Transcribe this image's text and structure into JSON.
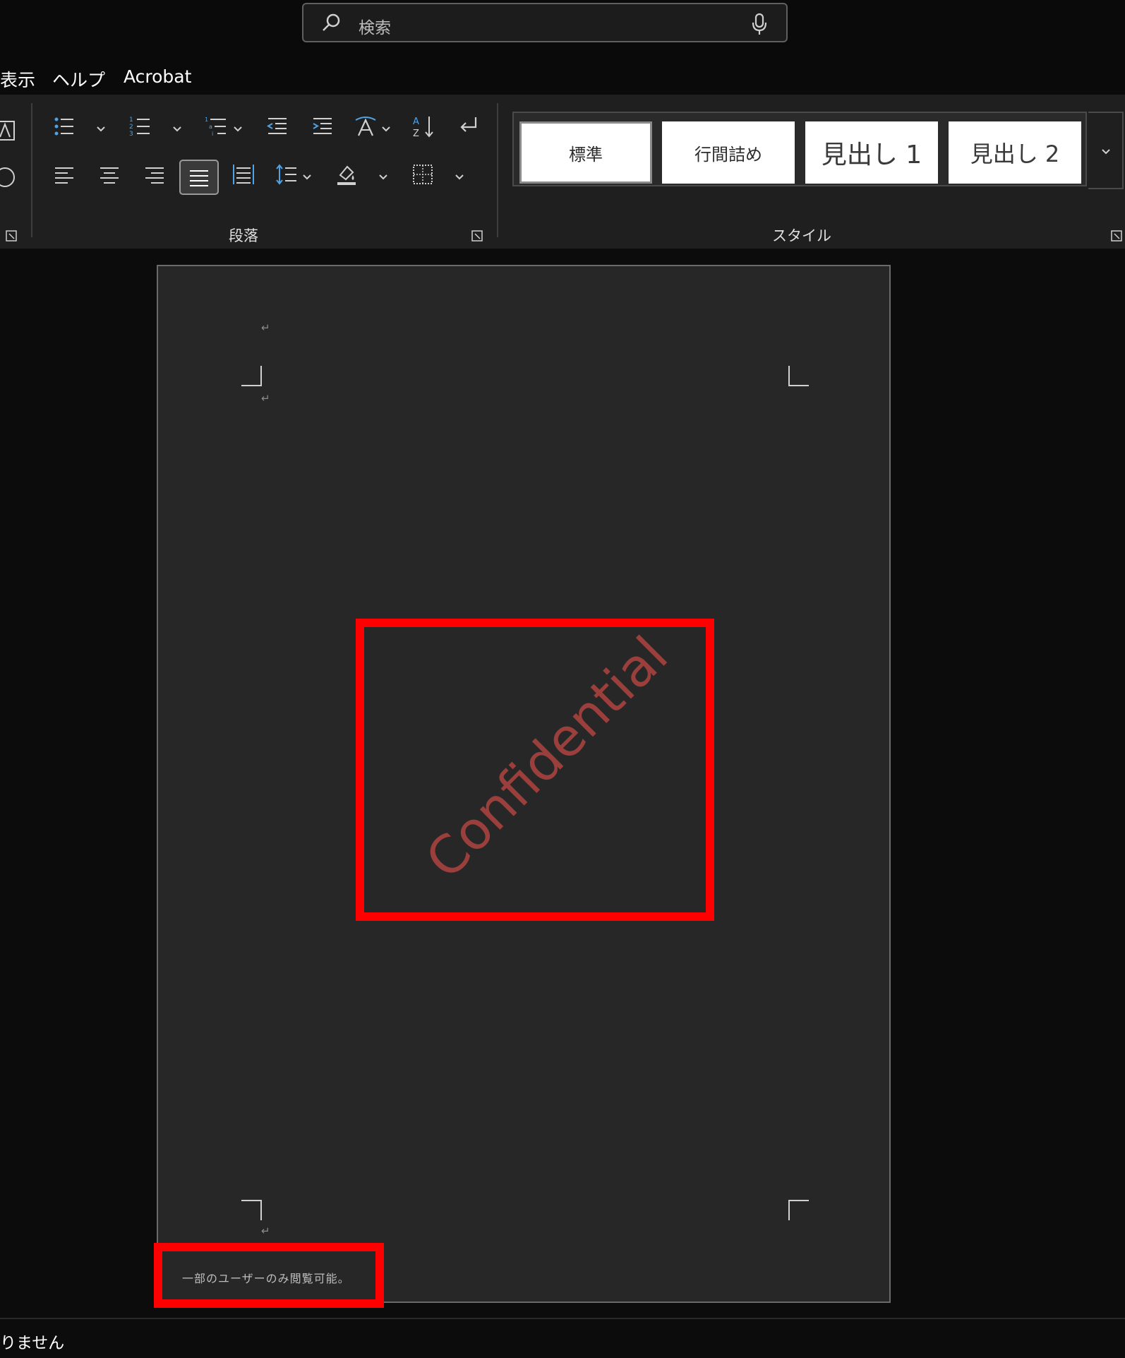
{
  "search": {
    "placeholder": "検索"
  },
  "menu": [
    "表示",
    "ヘルプ",
    "Acrobat"
  ],
  "ribbon": {
    "groups": {
      "paragraph": "段落",
      "styles": "スタイル"
    },
    "styles": [
      "標準",
      "行間詰め",
      "見出し 1",
      "見出し 2"
    ]
  },
  "document": {
    "watermark": "Confidential",
    "footer_note": "一部のユーザーのみ閲覧可能。",
    "paragraph_mark": "↵"
  },
  "status": {
    "text": "りません"
  },
  "colors": {
    "accent_blue": "#4ea3e6",
    "highlight": "#ff0000",
    "watermark": "#9a3f3c"
  }
}
